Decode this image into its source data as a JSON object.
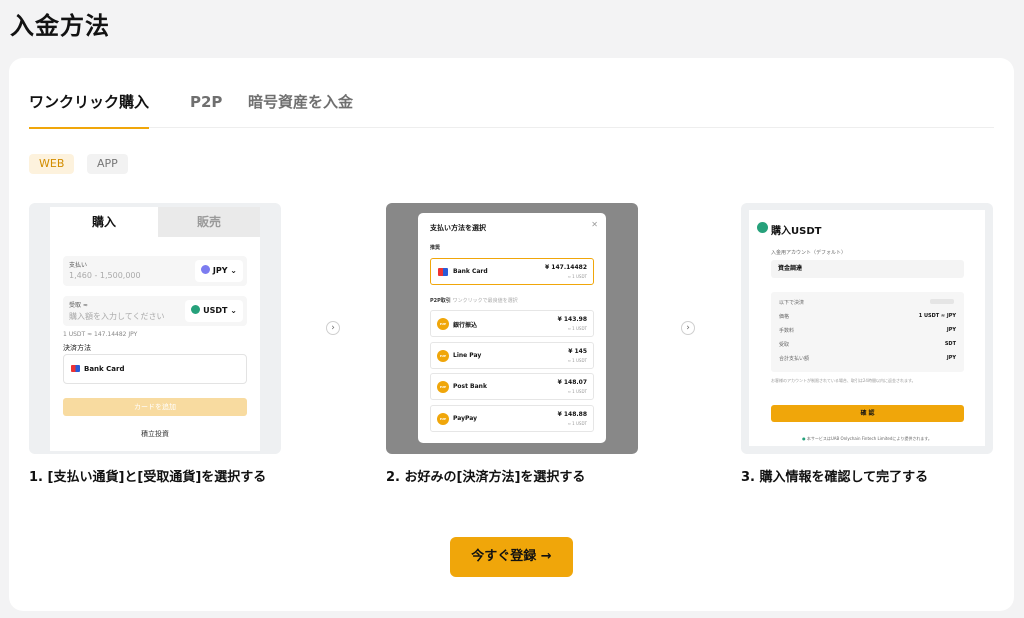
{
  "page": {
    "title": "入金方法"
  },
  "tabs": [
    {
      "label": "ワンクリック購入",
      "active": true
    },
    {
      "label": "P2P",
      "active": false
    },
    {
      "label": "暗号資産を入金",
      "active": false
    }
  ],
  "platform_pills": [
    {
      "label": "WEB",
      "active": true
    },
    {
      "label": "APP",
      "active": false
    }
  ],
  "steps": [
    {
      "caption": "1. [支払い通貨]と[受取通貨]を選択する"
    },
    {
      "caption": "2. お好みの[決済方法]を選択する"
    },
    {
      "caption": "3. 購入情報を確認して完了する"
    }
  ],
  "mock1": {
    "tab_buy": "購入",
    "tab_sell": "販売",
    "pay_label": "支払い",
    "pay_placeholder": "1,460 - 1,500,000",
    "pay_currency": "JPY",
    "receive_label": "受取 ≈",
    "receive_placeholder": "購入額を入力してください",
    "receive_currency": "USDT",
    "rate": "1 USDT ≈ 147.14482 JPY",
    "method_label": "決済方法",
    "method_value": "Bank Card",
    "submit": "カードを追加",
    "footer": "積立投資"
  },
  "mock2": {
    "title": "支払い方法を選択",
    "section_recent": "推奨",
    "section_p2p": "P2P取引",
    "section_p2p_note": "ワンクリックで最良値を選択",
    "card_name": "Bank Card",
    "card_price": "¥ 147.14482",
    "card_sub": "≈ 1 USDT",
    "badge": "P2P",
    "methods": [
      {
        "name": "銀行振込",
        "price": "¥ 143.98",
        "sub": "≈ 1 USDT"
      },
      {
        "name": "Line Pay",
        "price": "¥ 145",
        "sub": "≈ 1 USDT"
      },
      {
        "name": "Post Bank",
        "price": "¥ 148.07",
        "sub": "≈ 1 USDT"
      },
      {
        "name": "PayPay",
        "price": "¥ 148.88",
        "sub": "≈ 1 USDT"
      }
    ]
  },
  "mock3": {
    "title": "購入USDT",
    "account_label": "入金用アカウント（デフォルト）",
    "account_value": "資金調達",
    "rows": [
      {
        "k": "以下で決済",
        "v": ""
      },
      {
        "k": "価格",
        "v": "1 USDT ≈ JPY"
      },
      {
        "k": "手数料",
        "v": "JPY"
      },
      {
        "k": "受取",
        "v": "SDT"
      },
      {
        "k": "合計支払い額",
        "v": "JPY"
      }
    ],
    "note": "お客様のアカウントが制限されている場合、取引は24時間以内に返金されます。",
    "confirm": "確 認",
    "footer": "本サービスはUAB Onlychain Fintech Limitedにより提供されます。"
  },
  "cta": {
    "label": "今すぐ登録 →"
  },
  "colors": {
    "accent": "#f0a60a",
    "text": "#121212",
    "muted": "#6f6f6f"
  }
}
